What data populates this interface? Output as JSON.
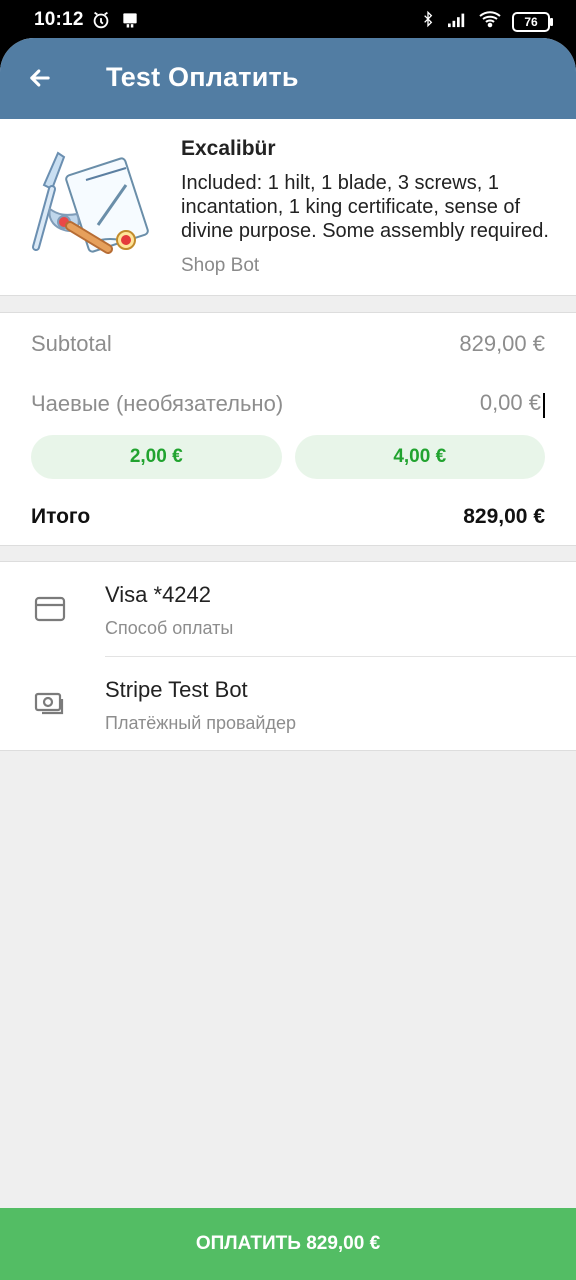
{
  "status_bar": {
    "time": "10:12",
    "battery": "76"
  },
  "header": {
    "title": "Test Оплатить"
  },
  "product": {
    "name": "Excalibür",
    "description": "Included: 1 hilt, 1 blade, 3 screws, 1 incantation, 1 king certificate, sense of divine purpose. Some assembly required.",
    "shop": "Shop Bot"
  },
  "summary": {
    "subtotal_label": "Subtotal",
    "subtotal_value": "829,00 €",
    "tips_label": "Чаевые (необязательно)",
    "tips_value": "0,00 €",
    "tip_options": [
      "2,00 €",
      "4,00 €"
    ],
    "total_label": "Итого",
    "total_value": "829,00 €"
  },
  "payment": {
    "card_title": "Visa *4242",
    "card_subtitle": "Способ оплаты",
    "provider_title": "Stripe Test Bot",
    "provider_subtitle": "Платёжный провайдер"
  },
  "pay_button": {
    "label": "ОПЛАТИТЬ 829,00 €"
  },
  "colors": {
    "header": "#527da3",
    "pay_button": "#53bd64",
    "tip_text": "#21a32f"
  }
}
